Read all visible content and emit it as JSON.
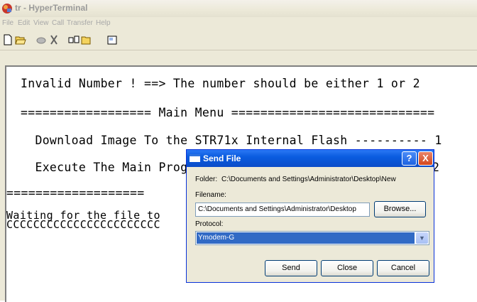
{
  "window": {
    "title": "tr - HyperTerminal"
  },
  "menu": [
    "File",
    "Edit",
    "View",
    "Call",
    "Transfer",
    "Help"
  ],
  "toolbar": {
    "buttons": [
      "new-icon",
      "open-icon",
      "connect-icon",
      "disconnect-icon",
      "send-icon",
      "receive-icon",
      "properties-icon"
    ]
  },
  "terminal": {
    "lines": [
      "Invalid Number ! ==> The number should be either 1 or 2",
      "================== Main Menu ============================",
      "  Download Image To the STR71x Internal Flash ---------- 1",
      "  Execute The Main Progr",
      "===================",
      "Waiting for the file to",
      "CCCCCCCCCCCCCCCCCCCCCCC"
    ],
    "partial_right_digit": "2"
  },
  "dialog": {
    "title": "Send File",
    "folder_label": "Folder:",
    "folder_path": "C:\\Documents and Settings\\Administrator\\Desktop\\New",
    "filename_label": "Filename:",
    "filename_value": "C:\\Documents and Settings\\Administrator\\Desktop",
    "browse_label": "Browse...",
    "protocol_label": "Protocol:",
    "protocol_value": "Ymodem-G",
    "send_label": "Send",
    "close_label": "Close",
    "cancel_label": "Cancel",
    "help_glyph": "?",
    "close_glyph": "X"
  }
}
